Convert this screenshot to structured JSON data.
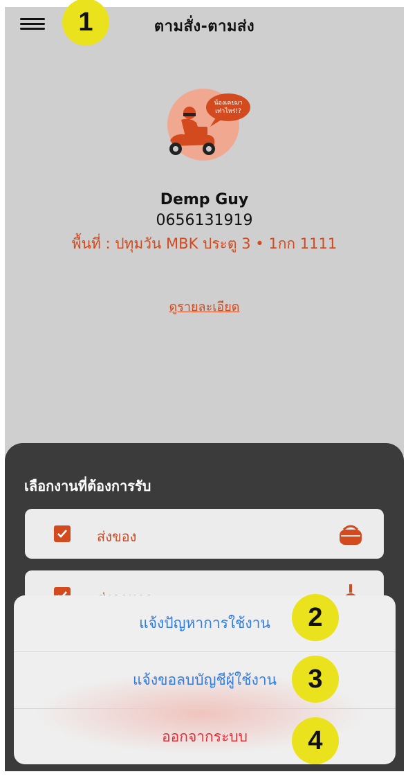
{
  "header": {
    "title": "ตามสั่ง-ตามส่ง",
    "menu_icon": "hamburger-menu-icon"
  },
  "markers": [
    "1",
    "2",
    "3",
    "4"
  ],
  "avatar": {
    "speech_text_line1": "น้องเคยมา",
    "speech_text_line2": "เท่าไหร่!?",
    "accent_color": "#d24a1e"
  },
  "profile": {
    "name": "Demp Guy",
    "phone": "0656131919",
    "area": "พื้นที่ : ปทุมวัน MBK ประตู 3 • 1กก 1111",
    "details_link": "ดูรายละเอียด"
  },
  "jobs": {
    "title": "เลือกงานที่ต้องการรับ",
    "items": [
      {
        "label": "ส่งของ",
        "checked": true,
        "icon": "delivery-box-icon"
      },
      {
        "label": "ส่งอาหาร",
        "checked": true,
        "icon": "food-icon"
      }
    ]
  },
  "action_sheet": {
    "report_problem": "แจ้งปัญหาการใช้งาน",
    "request_delete_account": "แจ้งขอลบบัญชีผู้ใช้งาน",
    "logout": "ออกจากระบบ"
  }
}
